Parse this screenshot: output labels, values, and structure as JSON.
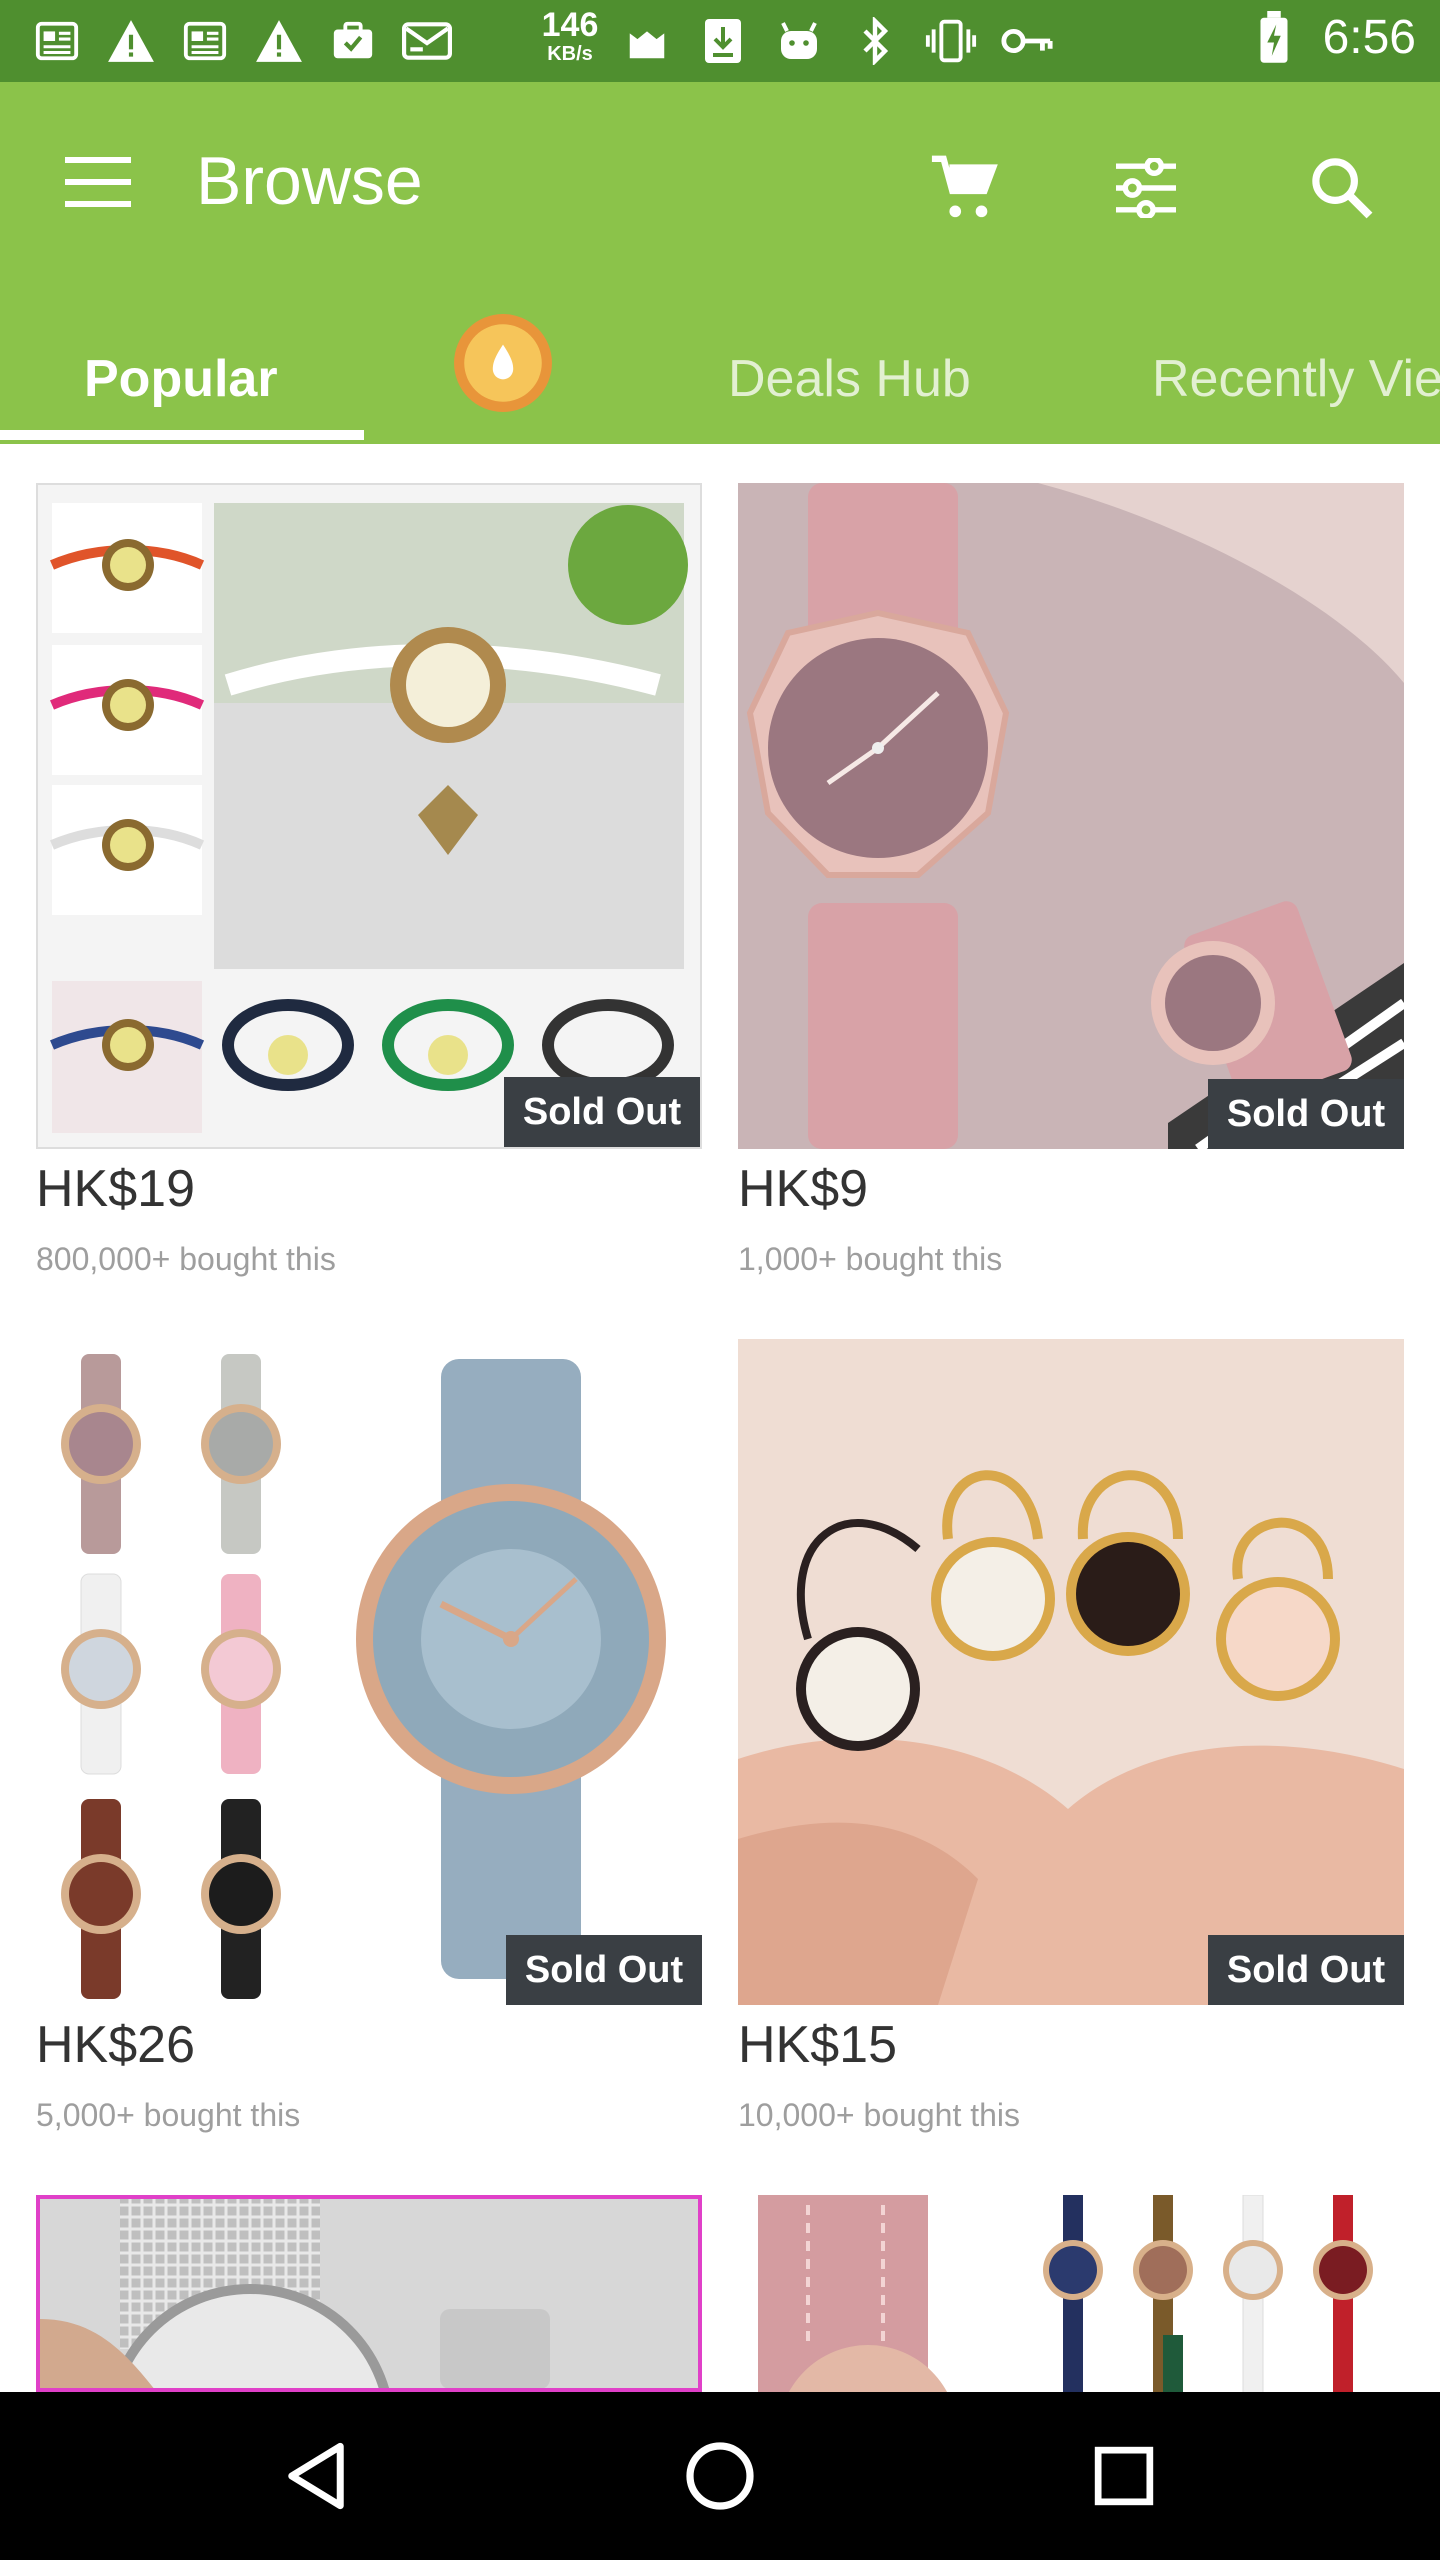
{
  "status_bar": {
    "net_speed_value": "146",
    "net_speed_unit": "KB/s",
    "time": "6:56",
    "icons": [
      "news-icon",
      "warning-icon",
      "news-icon",
      "warning-icon",
      "briefcase-check-icon",
      "mail-icon",
      "cat-icon",
      "download-icon",
      "android-icon",
      "bluetooth-icon",
      "vibrate-icon",
      "key-icon",
      "battery-charging-icon"
    ]
  },
  "app_bar": {
    "title": "Browse",
    "icons": {
      "menu": "hamburger-menu-icon",
      "cart": "shopping-cart-icon",
      "filter": "filter-sliders-icon",
      "search": "search-icon"
    }
  },
  "tabs": {
    "popular": "Popular",
    "deals": "Deals Hub",
    "recent": "Recently Vie"
  },
  "products": [
    {
      "price": "HK$19",
      "bought": "800,000+ bought this",
      "badge": "Sold Out"
    },
    {
      "price": "HK$9",
      "bought": "1,000+ bought this",
      "badge": "Sold Out"
    },
    {
      "price": "HK$26",
      "bought": "5,000+ bought this",
      "badge": "Sold Out"
    },
    {
      "price": "HK$15",
      "bought": "10,000+ bought this",
      "badge": "Sold Out"
    }
  ],
  "colors": {
    "status_bar": "#4f8f2f",
    "app_bar": "#8bc34a",
    "sold_out_badge": "#3a3f44",
    "nav_bar": "#000000"
  }
}
